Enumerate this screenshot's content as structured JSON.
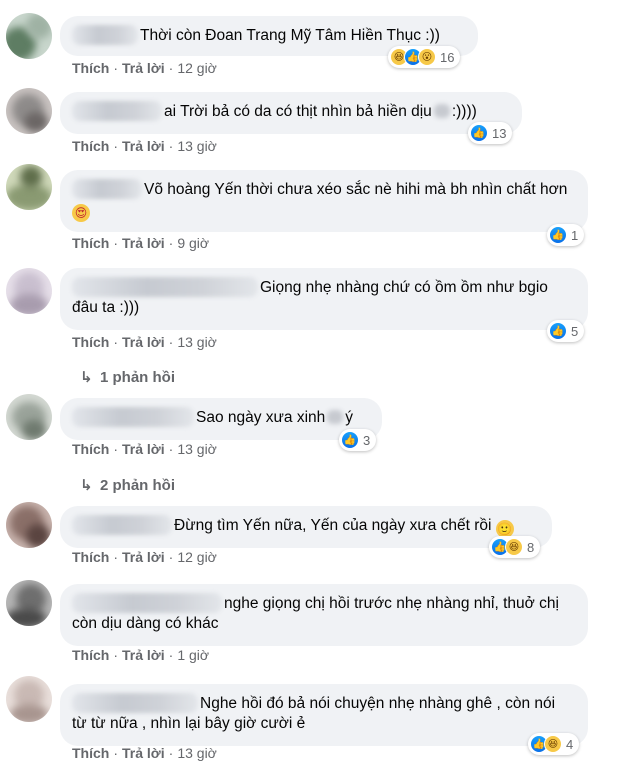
{
  "comments": [
    {
      "text": "Thời còn Đoan Trang Mỹ Tâm Hiền Thục :))",
      "actions": {
        "like": "Thích",
        "sep": "·",
        "reply": "Trả lời",
        "time": "12 giờ"
      },
      "reactions": {
        "icons": [
          "haha-icon",
          "like-icon",
          "wow-icon"
        ],
        "count": "16"
      },
      "avatar_colors": [
        "#5e7d63",
        "#c8d6cc",
        "#9fb2a4"
      ]
    },
    {
      "text": "ai Trời bả có da có thịt nhìn bả hiền dịu",
      "text_tail": ":))))",
      "actions": {
        "like": "Thích",
        "sep": "·",
        "reply": "Trả lời",
        "time": "13 giờ"
      },
      "reactions": {
        "icons": [
          "like-icon"
        ],
        "count": "13"
      },
      "avatar_colors": [
        "#8e8b8a",
        "#c9c3c1",
        "#6b6665"
      ]
    },
    {
      "text": "Võ hoàng Yến thời chưa xéo sắc nè hihi mà bh nhìn chất hơn",
      "actions": {
        "like": "Thích",
        "sep": "·",
        "reply": "Trả lời",
        "time": "9 giờ"
      },
      "reactions": {
        "icons": [
          "like-icon"
        ],
        "count": "1"
      },
      "avatar_colors": [
        "#8a9a72",
        "#cfd8b9",
        "#5f6e4b"
      ]
    },
    {
      "text": "Giọng nhẹ nhàng chứ có ồm ồm như bgio đâu ta :)))",
      "actions": {
        "like": "Thích",
        "sep": "·",
        "reply": "Trả lời",
        "time": "13 giờ"
      },
      "reactions": {
        "icons": [
          "like-icon"
        ],
        "count": "5"
      },
      "avatar_colors": [
        "#c9bfcf",
        "#e6dfe9",
        "#a89cae"
      ],
      "replies": "1 phản hồi"
    },
    {
      "text": "Sao ngày xưa xinh",
      "text_tail": "ý",
      "actions": {
        "like": "Thích",
        "sep": "·",
        "reply": "Trả lời",
        "time": "13 giờ"
      },
      "reactions": {
        "icons": [
          "like-icon"
        ],
        "count": "3"
      },
      "avatar_colors": [
        "#9aa39a",
        "#d4d9d3",
        "#6f7a6f"
      ],
      "replies": "2 phản hồi"
    },
    {
      "text": "Đừng tìm Yến nữa, Yến của ngày xưa chết rồi",
      "actions": {
        "like": "Thích",
        "sep": "·",
        "reply": "Trả lời",
        "time": "12 giờ"
      },
      "reactions": {
        "icons": [
          "like-icon",
          "haha-icon"
        ],
        "count": "8"
      },
      "avatar_colors": [
        "#8a6f68",
        "#c8b3ad",
        "#5a4440"
      ]
    },
    {
      "text": "nghe giọng chị hồi trước nhẹ nhàng nhỉ, thuở chị còn dịu dàng có khác",
      "actions": {
        "like": "Thích",
        "sep": "·",
        "reply": "Trả lời",
        "time": "1 giờ"
      },
      "reactions": null,
      "avatar_colors": [
        "#6e6e6e",
        "#b5b5b5",
        "#4a4a4a"
      ]
    },
    {
      "text": "Nghe hồi đó bả nói chuyện nhẹ nhàng ghê , còn nói từ từ nữa , nhìn lại bây giờ cười ẻ",
      "actions": {
        "like": "Thích",
        "sep": "·",
        "reply": "Trả lời",
        "time": "13 giờ"
      },
      "reactions": {
        "icons": [
          "like-icon",
          "haha-icon"
        ],
        "count": "4"
      },
      "avatar_colors": [
        "#c9b9b4",
        "#e9dfdb",
        "#a8958f"
      ]
    }
  ]
}
